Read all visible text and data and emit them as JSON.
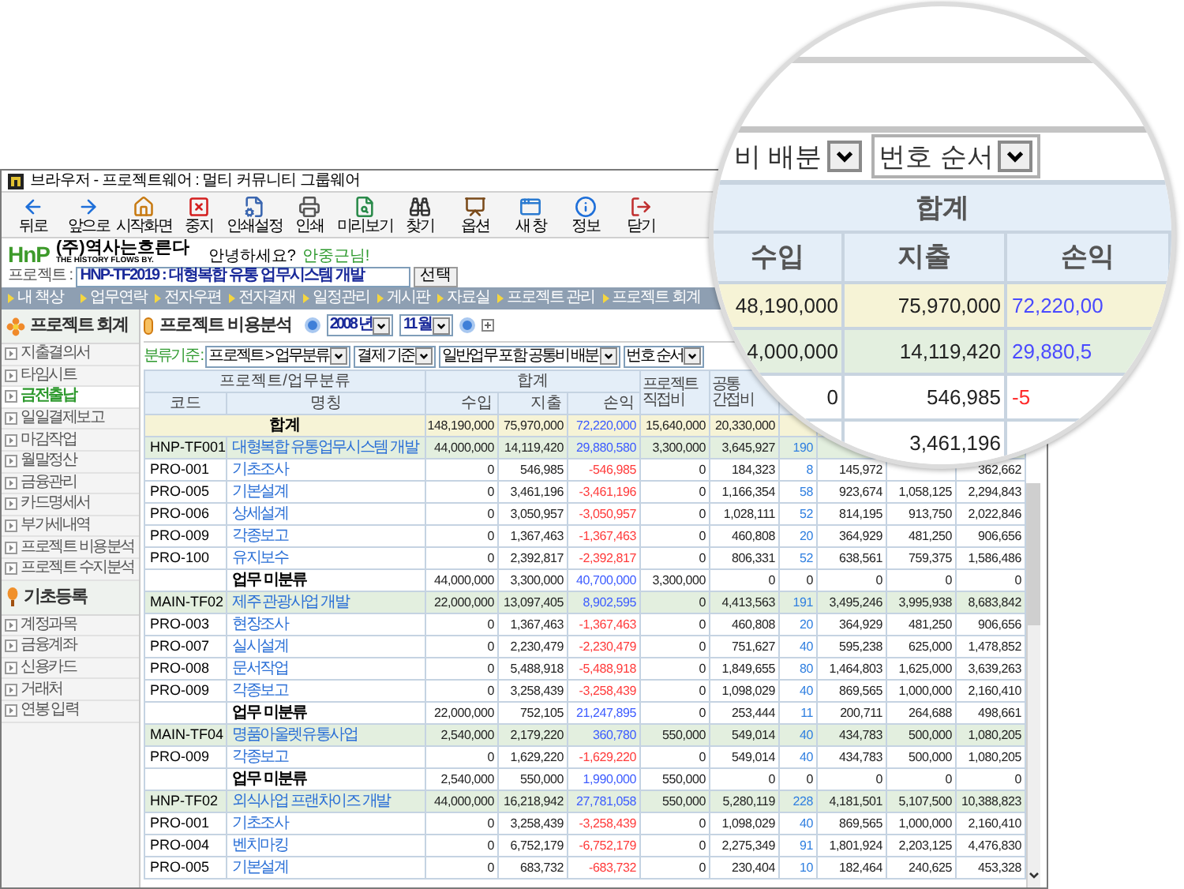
{
  "window": {
    "title": "브라우저 - 프로젝트웨어 : 멀티 커뮤니티 그룹웨어"
  },
  "toolbar": [
    "뒤로",
    "앞으로",
    "시작화면",
    "중지",
    "인쇄설정",
    "인쇄",
    "미리보기",
    "찾기",
    "옵션",
    "새 창",
    "정보",
    "닫기"
  ],
  "header": {
    "logo": "HnP",
    "company": "(주)역사는흐른다",
    "slogan": "THE HISTORY FLOWS BY.",
    "greeting": "안녕하세요?",
    "user": "안중근님!",
    "project_label": "프로젝트 :",
    "project_value": "HNP-TF2019 : 대형복합 유통 업무시스템 개발",
    "select_button": "선택"
  },
  "nav": [
    "내 책상",
    "업무연락",
    "전자우편",
    "전자결재",
    "일정관리",
    "게시판",
    "자료실",
    "프로젝트 관리",
    "프로젝트 회계"
  ],
  "sidebar": {
    "sections": [
      {
        "title": "프로젝트 회계",
        "items": [
          {
            "label": "지출결의서",
            "selected": false
          },
          {
            "label": "타임시트",
            "selected": false
          },
          {
            "label": "금전출납",
            "selected": true
          },
          {
            "label": "일일결제보고",
            "selected": false
          },
          {
            "label": "마감작업",
            "selected": false
          },
          {
            "label": "월말정산",
            "selected": false
          },
          {
            "label": "금융관리",
            "selected": false
          },
          {
            "label": "카드명세서",
            "selected": false
          },
          {
            "label": "부가세내역",
            "selected": false
          },
          {
            "label": "프로젝트 비용분석",
            "selected": false
          },
          {
            "label": "프로젝트 수지분석",
            "selected": false
          }
        ]
      },
      {
        "title": "기초등록",
        "items": [
          {
            "label": "계정과목",
            "selected": false
          },
          {
            "label": "금융계좌",
            "selected": false
          },
          {
            "label": "신용카드",
            "selected": false
          },
          {
            "label": "거래처",
            "selected": false
          },
          {
            "label": "연봉 입력",
            "selected": false
          }
        ]
      }
    ]
  },
  "page": {
    "title": "프로젝트 비용분석",
    "year": "2008 년",
    "month": "11 월"
  },
  "filter": {
    "label": "분류기준 :",
    "selects": [
      "프로젝트 > 업무분류",
      "결제 기준",
      "일반업무 포함 공통비 배분",
      "번호 순서"
    ]
  },
  "table": {
    "group_headers": [
      "프로젝트/업무분류",
      "합계"
    ],
    "columns": [
      "코드",
      "명칭",
      "수입",
      "지출",
      "손익"
    ],
    "side_headers": [
      "프로젝트 직접비",
      "공통 간접비"
    ],
    "rows": [
      {
        "kind": "total",
        "name": "합계",
        "values": {
          "income": "148,190,000",
          "expense": "75,970,000",
          "profit": "72,220,000",
          "direct_cost": "15,640,000",
          "indirect_cost": "20,330,000"
        }
      },
      {
        "kind": "project",
        "code": "HNP-TF001",
        "name": "대형복합 유통업무시스템 개발",
        "count_link": true,
        "values": {
          "income": "44,000,000",
          "expense": "14,119,420",
          "profit": "29,880,580",
          "direct_cost": "3,300,000",
          "indirect_cost": "3,645,927",
          "column_8": "190"
        }
      },
      {
        "kind": "task",
        "code": "PRO-001",
        "name": "기초조사",
        "count_link": true,
        "values": {
          "income": "0",
          "expense": "546,985",
          "profit": "-546,985",
          "direct_cost": "0",
          "indirect_cost": "184,323",
          "column_8": "8",
          "column_9": "145,972",
          "column_11": "362,662"
        }
      },
      {
        "kind": "task",
        "code": "PRO-005",
        "name": "기본설계",
        "count_link": true,
        "values": {
          "income": "0",
          "expense": "3,461,196",
          "profit": "-3,461,196",
          "direct_cost": "0",
          "indirect_cost": "1,166,354",
          "column_8": "58",
          "column_9": "923,674",
          "column_10": "1,058,125",
          "column_11": "2,294,843"
        }
      },
      {
        "kind": "task",
        "code": "PRO-006",
        "name": "상세설계",
        "count_link": true,
        "values": {
          "income": "0",
          "expense": "3,050,957",
          "profit": "-3,050,957",
          "direct_cost": "0",
          "indirect_cost": "1,028,111",
          "column_8": "52",
          "column_9": "814,195",
          "column_10": "913,750",
          "column_11": "2,022,846"
        }
      },
      {
        "kind": "task",
        "code": "PRO-009",
        "name": "각종보고",
        "count_link": true,
        "values": {
          "income": "0",
          "expense": "1,367,463",
          "profit": "-1,367,463",
          "direct_cost": "0",
          "indirect_cost": "460,808",
          "column_8": "20",
          "column_9": "364,929",
          "column_10": "481,250",
          "column_11": "906,656"
        }
      },
      {
        "kind": "task",
        "code": "PRO-100",
        "name": "유지보수",
        "count_link": true,
        "values": {
          "income": "0",
          "expense": "2,392,817",
          "profit": "-2,392,817",
          "direct_cost": "0",
          "indirect_cost": "806,331",
          "column_8": "52",
          "column_9": "638,561",
          "column_10": "759,375",
          "column_11": "1,586,486"
        }
      },
      {
        "kind": "unassigned",
        "name": "업무 미분류",
        "count_link": false,
        "values": {
          "income": "44,000,000",
          "expense": "3,300,000",
          "profit": "40,700,000",
          "direct_cost": "3,300,000",
          "indirect_cost": "0",
          "column_8": "0",
          "column_9": "0",
          "column_10": "0",
          "column_11": "0"
        }
      },
      {
        "kind": "project",
        "code": "MAIN-TF02",
        "name": "제주 관광사업 개발",
        "count_link": true,
        "values": {
          "income": "22,000,000",
          "expense": "13,097,405",
          "profit": "8,902,595",
          "direct_cost": "0",
          "indirect_cost": "4,413,563",
          "column_8": "191",
          "column_9": "3,495,246",
          "column_10": "3,995,938",
          "column_11": "8,683,842"
        }
      },
      {
        "kind": "task",
        "code": "PRO-003",
        "name": "현장조사",
        "count_link": true,
        "values": {
          "income": "0",
          "expense": "1,367,463",
          "profit": "-1,367,463",
          "direct_cost": "0",
          "indirect_cost": "460,808",
          "column_8": "20",
          "column_9": "364,929",
          "column_10": "481,250",
          "column_11": "906,656"
        }
      },
      {
        "kind": "task",
        "code": "PRO-007",
        "name": "실시설계",
        "count_link": true,
        "values": {
          "income": "0",
          "expense": "2,230,479",
          "profit": "-2,230,479",
          "direct_cost": "0",
          "indirect_cost": "751,627",
          "column_8": "40",
          "column_9": "595,238",
          "column_10": "625,000",
          "column_11": "1,478,852"
        }
      },
      {
        "kind": "task",
        "code": "PRO-008",
        "name": "문서작업",
        "count_link": true,
        "values": {
          "income": "0",
          "expense": "5,488,918",
          "profit": "-5,488,918",
          "direct_cost": "0",
          "indirect_cost": "1,849,655",
          "column_8": "80",
          "column_9": "1,464,803",
          "column_10": "1,625,000",
          "column_11": "3,639,263"
        }
      },
      {
        "kind": "task",
        "code": "PRO-009",
        "name": "각종보고",
        "count_link": true,
        "values": {
          "income": "0",
          "expense": "3,258,439",
          "profit": "-3,258,439",
          "direct_cost": "0",
          "indirect_cost": "1,098,029",
          "column_8": "40",
          "column_9": "869,565",
          "column_10": "1,000,000",
          "column_11": "2,160,410"
        }
      },
      {
        "kind": "unassigned",
        "name": "업무 미분류",
        "count_link": true,
        "values": {
          "income": "22,000,000",
          "expense": "752,105",
          "profit": "21,247,895",
          "direct_cost": "0",
          "indirect_cost": "253,444",
          "column_8": "11",
          "column_9": "200,711",
          "column_10": "264,688",
          "column_11": "498,661"
        }
      },
      {
        "kind": "project",
        "code": "MAIN-TF04",
        "name": "명품아울렛유통사업",
        "count_link": true,
        "values": {
          "income": "2,540,000",
          "expense": "2,179,220",
          "profit": "360,780",
          "direct_cost": "550,000",
          "indirect_cost": "549,014",
          "column_8": "40",
          "column_9": "434,783",
          "column_10": "500,000",
          "column_11": "1,080,205"
        }
      },
      {
        "kind": "task",
        "code": "PRO-009",
        "name": "각종보고",
        "count_link": true,
        "values": {
          "income": "0",
          "expense": "1,629,220",
          "profit": "-1,629,220",
          "direct_cost": "0",
          "indirect_cost": "549,014",
          "column_8": "40",
          "column_9": "434,783",
          "column_10": "500,000",
          "column_11": "1,080,205"
        }
      },
      {
        "kind": "unassigned",
        "name": "업무 미분류",
        "count_link": false,
        "values": {
          "income": "2,540,000",
          "expense": "550,000",
          "profit": "1,990,000",
          "direct_cost": "550,000",
          "indirect_cost": "0",
          "column_8": "0",
          "column_9": "0",
          "column_10": "0",
          "column_11": "0"
        }
      },
      {
        "kind": "project",
        "code": "HNP-TF02",
        "name": "외식사업 프랜차이즈 개발",
        "count_link": true,
        "values": {
          "income": "44,000,000",
          "expense": "16,218,942",
          "profit": "27,781,058",
          "direct_cost": "550,000",
          "indirect_cost": "5,280,119",
          "column_8": "228",
          "column_9": "4,181,501",
          "column_10": "5,107,500",
          "column_11": "10,388,823"
        }
      },
      {
        "kind": "task",
        "code": "PRO-001",
        "name": "기초조사",
        "count_link": true,
        "values": {
          "income": "0",
          "expense": "3,258,439",
          "profit": "-3,258,439",
          "direct_cost": "0",
          "indirect_cost": "1,098,029",
          "column_8": "40",
          "column_9": "869,565",
          "column_10": "1,000,000",
          "column_11": "2,160,410"
        }
      },
      {
        "kind": "task",
        "code": "PRO-004",
        "name": "벤치마킹",
        "count_link": true,
        "values": {
          "income": "0",
          "expense": "6,752,179",
          "profit": "-6,752,179",
          "direct_cost": "0",
          "indirect_cost": "2,275,349",
          "column_8": "91",
          "column_9": "1,801,924",
          "column_10": "2,203,125",
          "column_11": "4,476,830"
        }
      },
      {
        "kind": "task",
        "code": "PRO-005",
        "name": "기본설계",
        "count_link": true,
        "values": {
          "income": "0",
          "expense": "683,732",
          "profit": "-683,732",
          "direct_cost": "0",
          "indirect_cost": "230,404",
          "column_8": "10",
          "column_9": "182,464",
          "column_10": "240,625",
          "column_11": "453,328"
        }
      }
    ]
  },
  "magnifier": {
    "selects": [
      "비 배분",
      "번호 순서"
    ],
    "group_header": "합계",
    "columns": [
      "수입",
      "지출",
      "손익"
    ],
    "rows": [
      {
        "kind": "total",
        "income": "48,190,000",
        "expense": "75,970,000",
        "profit": "72,220,00"
      },
      {
        "kind": "project",
        "income": "4,000,000",
        "expense": "14,119,420",
        "profit": "29,880,5"
      },
      {
        "kind": "task",
        "income": "0",
        "expense": "546,985",
        "profit": "-5"
      },
      {
        "kind": "task",
        "expense": "3,461,196"
      }
    ]
  }
}
